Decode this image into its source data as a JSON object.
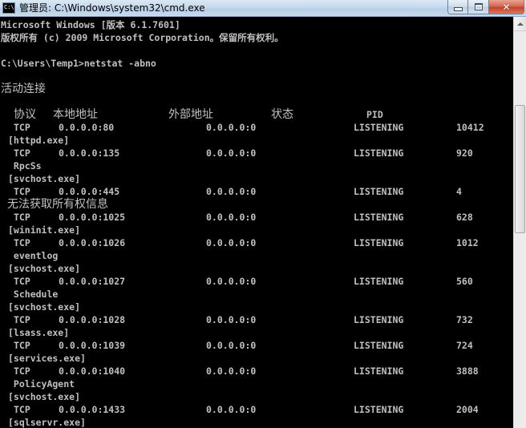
{
  "window": {
    "title": "管理员: C:\\Windows\\system32\\cmd.exe",
    "icon_text": "C:\\",
    "buttons": {
      "minimize": "minimize",
      "maximize": "maximize",
      "close": "✕"
    }
  },
  "console": {
    "banner_line1": "Microsoft Windows [版本 6.1.7601]",
    "banner_line2": "版权所有 (c) 2009 Microsoft Corporation。保留所有权利。",
    "prompt": "C:\\Users\\Temp1>netstat -abno",
    "section_title": "活动连接",
    "headers": {
      "proto": "协议",
      "local": "本地地址",
      "foreign": "外部地址",
      "state": "状态",
      "pid": "PID"
    },
    "rows": [
      {
        "proto": "TCP",
        "local": "0.0.0.0:80",
        "foreign": "0.0.0.0:0",
        "state": "LISTENING",
        "pid": "10412"
      },
      {
        "extra": "[httpd.exe]"
      },
      {
        "proto": "TCP",
        "local": "0.0.0.0:135",
        "foreign": "0.0.0.0:0",
        "state": "LISTENING",
        "pid": "920"
      },
      {
        "extra": " RpcSs"
      },
      {
        "extra": "[svchost.exe]"
      },
      {
        "proto": "TCP",
        "local": "0.0.0.0:445",
        "foreign": "0.0.0.0:0",
        "state": "LISTENING",
        "pid": "4"
      },
      {
        "extra_cjk": "无法获取所有权信息"
      },
      {
        "proto": "TCP",
        "local": "0.0.0.0:1025",
        "foreign": "0.0.0.0:0",
        "state": "LISTENING",
        "pid": "628"
      },
      {
        "extra": "[wininit.exe]"
      },
      {
        "proto": "TCP",
        "local": "0.0.0.0:1026",
        "foreign": "0.0.0.0:0",
        "state": "LISTENING",
        "pid": "1012"
      },
      {
        "extra": " eventlog"
      },
      {
        "extra": "[svchost.exe]"
      },
      {
        "proto": "TCP",
        "local": "0.0.0.0:1027",
        "foreign": "0.0.0.0:0",
        "state": "LISTENING",
        "pid": "560"
      },
      {
        "extra": " Schedule"
      },
      {
        "extra": "[svchost.exe]"
      },
      {
        "proto": "TCP",
        "local": "0.0.0.0:1028",
        "foreign": "0.0.0.0:0",
        "state": "LISTENING",
        "pid": "732"
      },
      {
        "extra": "[lsass.exe]"
      },
      {
        "proto": "TCP",
        "local": "0.0.0.0:1039",
        "foreign": "0.0.0.0:0",
        "state": "LISTENING",
        "pid": "724"
      },
      {
        "extra": "[services.exe]"
      },
      {
        "proto": "TCP",
        "local": "0.0.0.0:1040",
        "foreign": "0.0.0.0:0",
        "state": "LISTENING",
        "pid": "3888"
      },
      {
        "extra": " PolicyAgent"
      },
      {
        "extra": "[svchost.exe]"
      },
      {
        "proto": "TCP",
        "local": "0.0.0.0:1433",
        "foreign": "0.0.0.0:0",
        "state": "LISTENING",
        "pid": "2004"
      },
      {
        "extra": "[sqlservr.exe]"
      }
    ]
  },
  "colors": {
    "console_bg": "#000000",
    "console_fg": "#c0c0c0",
    "titlebar": "#c5d9ec",
    "close_button": "#c44427"
  }
}
